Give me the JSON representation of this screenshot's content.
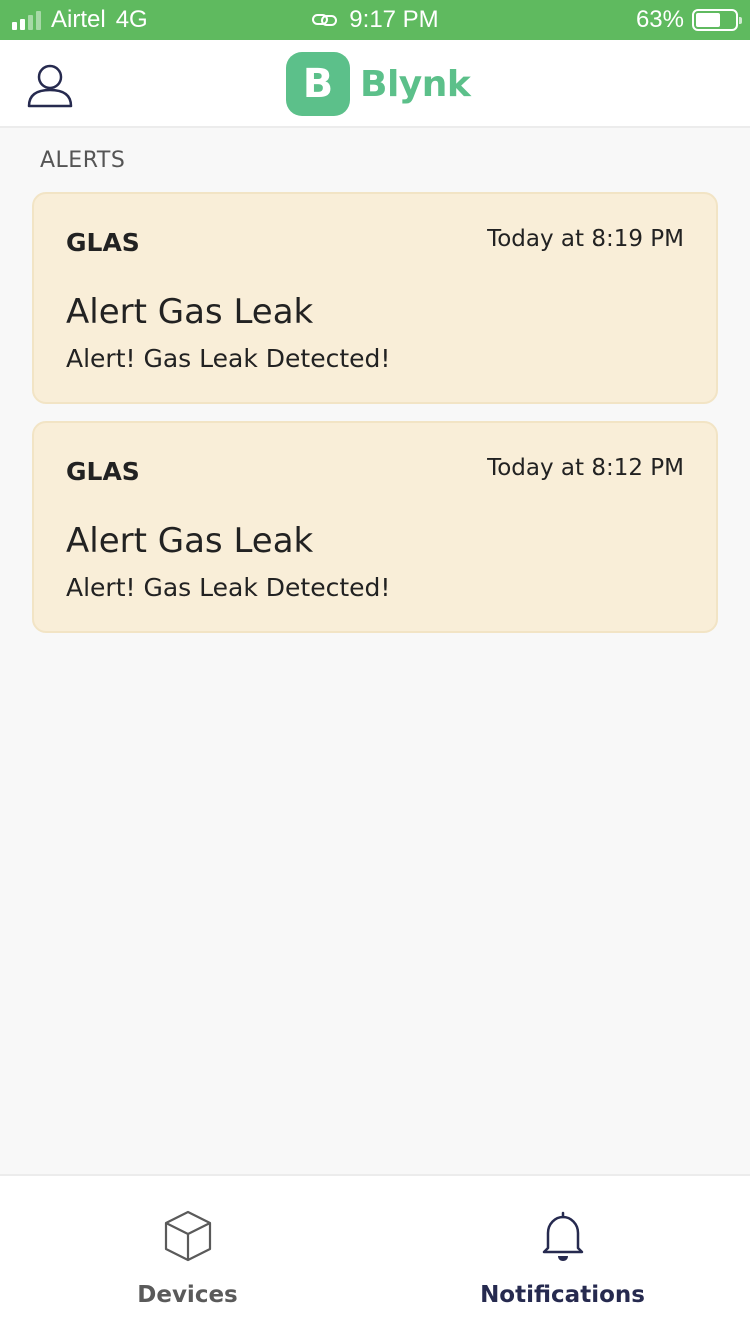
{
  "status_bar": {
    "carrier": "Airtel",
    "network": "4G",
    "time": "9:17 PM",
    "battery_percent": "63%",
    "battery_level": 0.63,
    "icons": [
      "signal-icon",
      "link-icon",
      "battery-icon"
    ]
  },
  "header": {
    "logo_letter": "B",
    "logo_text": "Blynk",
    "icons": [
      "profile-icon"
    ],
    "brand_color": "#5cc08a"
  },
  "section": {
    "label": "ALERTS"
  },
  "alerts": [
    {
      "source": "GLAS",
      "time": "Today at 8:19 PM",
      "title": "Alert Gas Leak",
      "message": "Alert! Gas Leak Detected!"
    },
    {
      "source": "GLAS",
      "time": "Today at 8:12 PM",
      "title": "Alert Gas Leak",
      "message": "Alert! Gas Leak Detected!"
    }
  ],
  "bottom_nav": {
    "items": [
      {
        "label": "Devices",
        "icon": "cube-icon",
        "active": false
      },
      {
        "label": "Notifications",
        "icon": "bell-icon",
        "active": true
      }
    ]
  },
  "colors": {
    "status_bar": "#5fba5f",
    "card_background": "#f9eed8",
    "active_nav": "#262a4f"
  }
}
